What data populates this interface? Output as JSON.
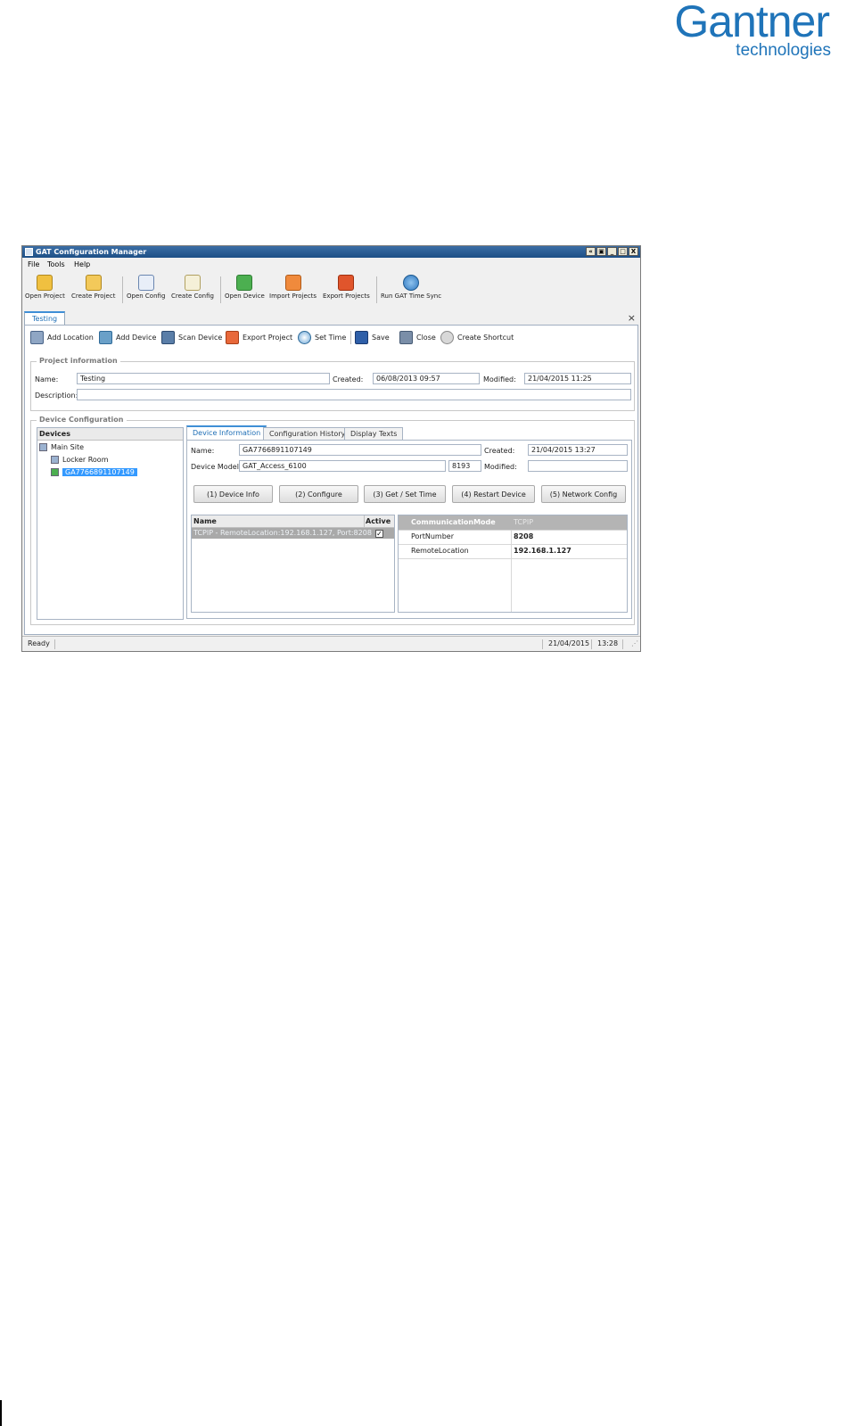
{
  "logo": {
    "brand": "Gantner",
    "tagline": "technologies"
  },
  "window": {
    "title": "GAT Configuration Manager",
    "controls": [
      "«",
      "▣",
      "_",
      "□",
      "X"
    ]
  },
  "menu": [
    "File",
    "Tools",
    "Help"
  ],
  "main_toolbar": [
    {
      "label": "Open Project",
      "icon": "folder-gear-icon"
    },
    {
      "label": "Create Project",
      "icon": "folder-new-icon"
    },
    {
      "label": "Open Config",
      "icon": "config-open-icon"
    },
    {
      "label": "Create Config",
      "icon": "config-new-icon"
    },
    {
      "label": "Open Device",
      "icon": "device-open-icon"
    },
    {
      "label": "Import Projects",
      "icon": "import-icon"
    },
    {
      "label": "Export Projects",
      "icon": "export-icon"
    },
    {
      "label": "Run GAT Time Sync",
      "icon": "globe-clock-icon"
    }
  ],
  "doc_tab": {
    "label": "Testing",
    "close": "×"
  },
  "secondary_toolbar": [
    {
      "label": "Add Location",
      "icon": "building-add-icon"
    },
    {
      "label": "Add Device",
      "icon": "device-add-icon"
    },
    {
      "label": "Scan Device",
      "icon": "scan-device-icon"
    },
    {
      "label": "Export Project",
      "icon": "export-project-icon"
    },
    {
      "label": "Set Time",
      "icon": "clock-icon"
    },
    {
      "label": "Save",
      "icon": "floppy-icon"
    },
    {
      "label": "Close",
      "icon": "door-icon"
    },
    {
      "label": "Create Shortcut",
      "icon": "shortcut-icon"
    }
  ],
  "project_info": {
    "legend": "Project information",
    "name_label": "Name:",
    "name_value": "Testing",
    "created_label": "Created:",
    "created_value": "06/08/2013 09:57",
    "modified_label": "Modified:",
    "modified_value": "21/04/2015 11:25",
    "description_label": "Description:",
    "description_value": ""
  },
  "device_config": {
    "legend": "Device Configuration",
    "devices_header": "Devices",
    "tree": [
      {
        "label": "Main Site",
        "level": 0
      },
      {
        "label": "Locker Room",
        "level": 1
      },
      {
        "label": "GA7766891107149",
        "level": 1,
        "selected": true
      }
    ],
    "tabs": [
      "Device Information",
      "Configuration History",
      "Display Texts"
    ],
    "active_tab": 0,
    "name_label": "Name:",
    "name_value": "GA7766891107149",
    "created_label": "Created:",
    "created_value": "21/04/2015 13:27",
    "model_label": "Device Model:",
    "model_value": "GAT_Access_6100",
    "model_code": "8193",
    "modified_label": "Modified:",
    "modified_value": "",
    "actions": [
      "(1) Device Info",
      "(2) Configure",
      "(3) Get / Set Time",
      "(4) Restart Device",
      "(5) Network Config"
    ],
    "comm_grid": {
      "headers": [
        "Name",
        "Active"
      ],
      "rows": [
        {
          "name": "TCPIP - RemoteLocation:192.168.1.127, Port:8208",
          "active": true
        }
      ]
    },
    "properties": [
      {
        "key": "CommunicationMode",
        "value": "TCPIP"
      },
      {
        "key": "PortNumber",
        "value": "8208"
      },
      {
        "key": "RemoteLocation",
        "value": "192.168.1.127"
      }
    ]
  },
  "status": {
    "text": "Ready",
    "date": "21/04/2015",
    "time": "13:28"
  }
}
